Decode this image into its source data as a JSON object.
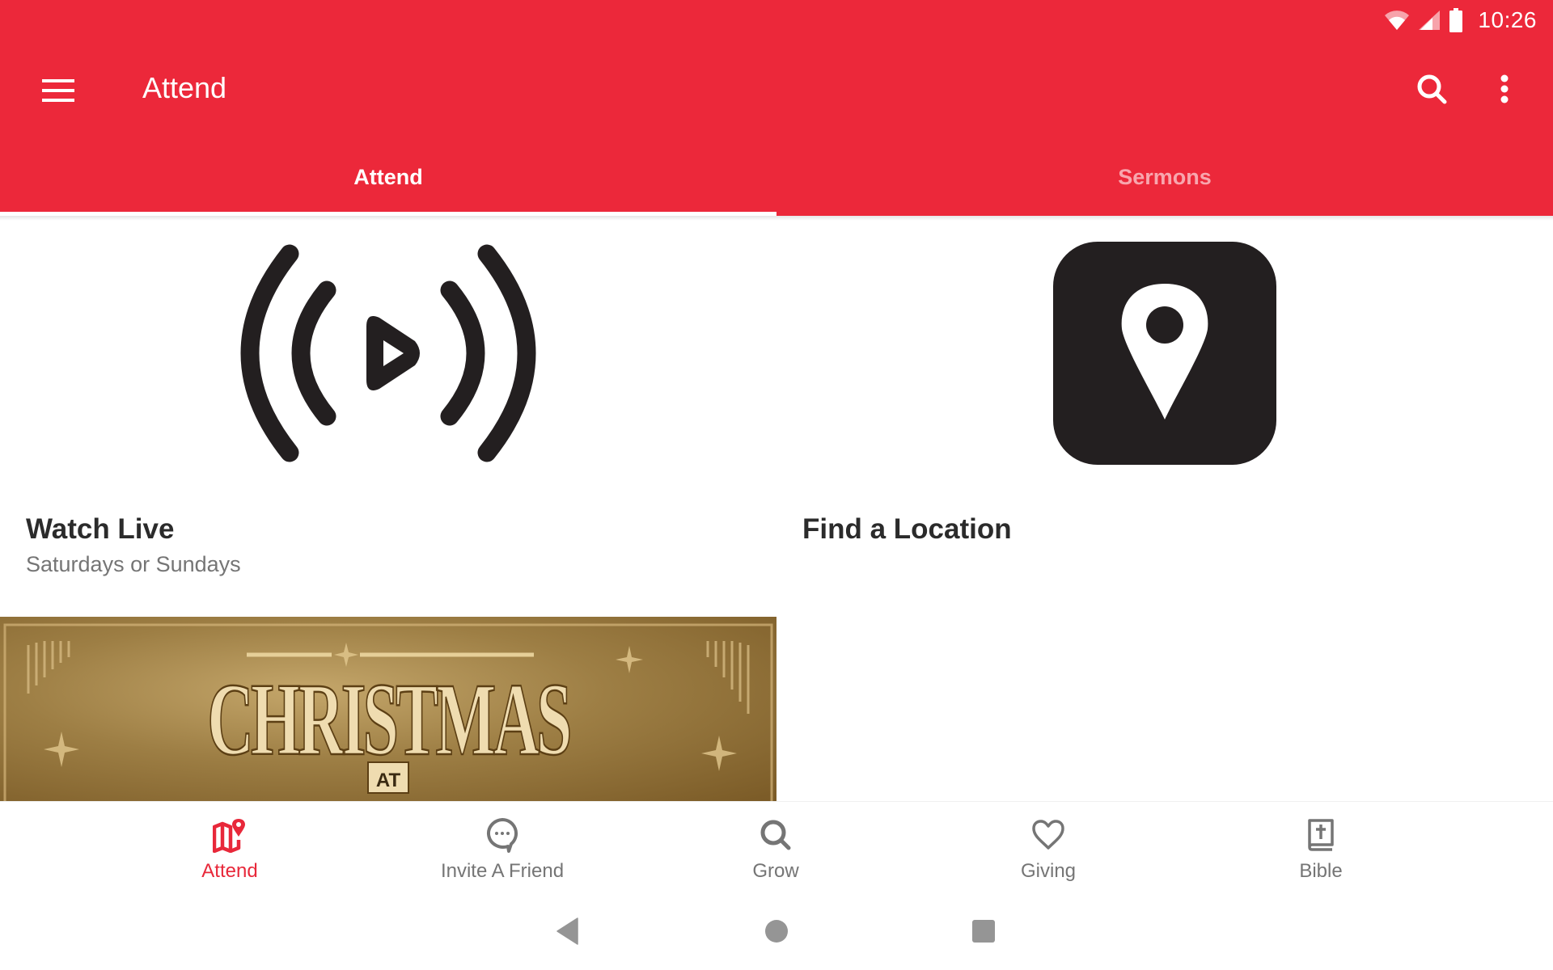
{
  "colors": {
    "primary": "#ec283a",
    "active_nav": "#e8283a",
    "inactive_nav": "#757575",
    "tab_inactive": "#f8a6ae"
  },
  "status_bar": {
    "time": "10:26",
    "icons": [
      "wifi-icon",
      "cell-signal-icon",
      "battery-icon"
    ]
  },
  "toolbar": {
    "title": "Attend",
    "menu_icon": "hamburger-menu-icon",
    "search_icon": "search-icon",
    "more_icon": "more-vert-icon"
  },
  "tabs": [
    {
      "label": "Attend",
      "active": true
    },
    {
      "label": "Sermons",
      "active": false
    }
  ],
  "cards": [
    {
      "title": "Watch Live",
      "subtitle": "Saturdays or Sundays",
      "icon": "live-broadcast-icon"
    },
    {
      "title": "Find a Location",
      "subtitle": "",
      "icon": "location-pin-icon"
    }
  ],
  "banner": {
    "title_text": "CHRISTMAS",
    "sub_text": "AT"
  },
  "bottom_nav": [
    {
      "label": "Attend",
      "icon": "map-pin-icon",
      "active": true
    },
    {
      "label": "Invite A Friend",
      "icon": "chat-bubble-icon",
      "active": false
    },
    {
      "label": "Grow",
      "icon": "search-icon",
      "active": false
    },
    {
      "label": "Giving",
      "icon": "heart-icon",
      "active": false
    },
    {
      "label": "Bible",
      "icon": "bible-icon",
      "active": false
    }
  ],
  "system_nav": [
    "back",
    "home",
    "recents"
  ]
}
